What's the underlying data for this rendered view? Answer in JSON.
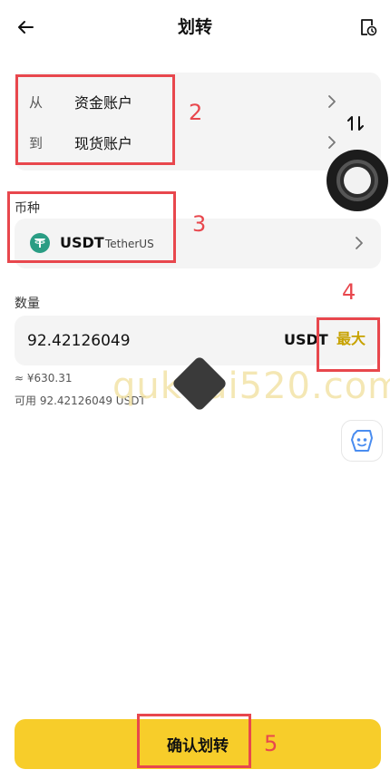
{
  "header": {
    "title": "划转",
    "back_icon": "arrow-left-icon",
    "history_icon": "document-clock-icon"
  },
  "transfer": {
    "from_label": "从",
    "from_account": "资金账户",
    "to_label": "到",
    "to_account": "现货账户",
    "swap_icon": "swap-vertical-icon"
  },
  "coin": {
    "section_label": "币种",
    "symbol": "USDT",
    "name": "TetherUS",
    "icon": "tether-icon",
    "icon_color": "#2a9d84"
  },
  "amount": {
    "section_label": "数量",
    "value": "92.42126049",
    "unit": "USDT",
    "max_label": "最大",
    "approx": "≈ ¥630.31",
    "available": "可用 92.42126049 USDT"
  },
  "watermark": "qukuai520.com",
  "confirm_label": "确认划转",
  "annotations": [
    "2",
    "3",
    "4",
    "5"
  ],
  "colors": {
    "accent": "#f7cd2a",
    "max_text": "#c7a200",
    "annotation": "#e8474d",
    "card_bg": "#f4f4f4"
  }
}
